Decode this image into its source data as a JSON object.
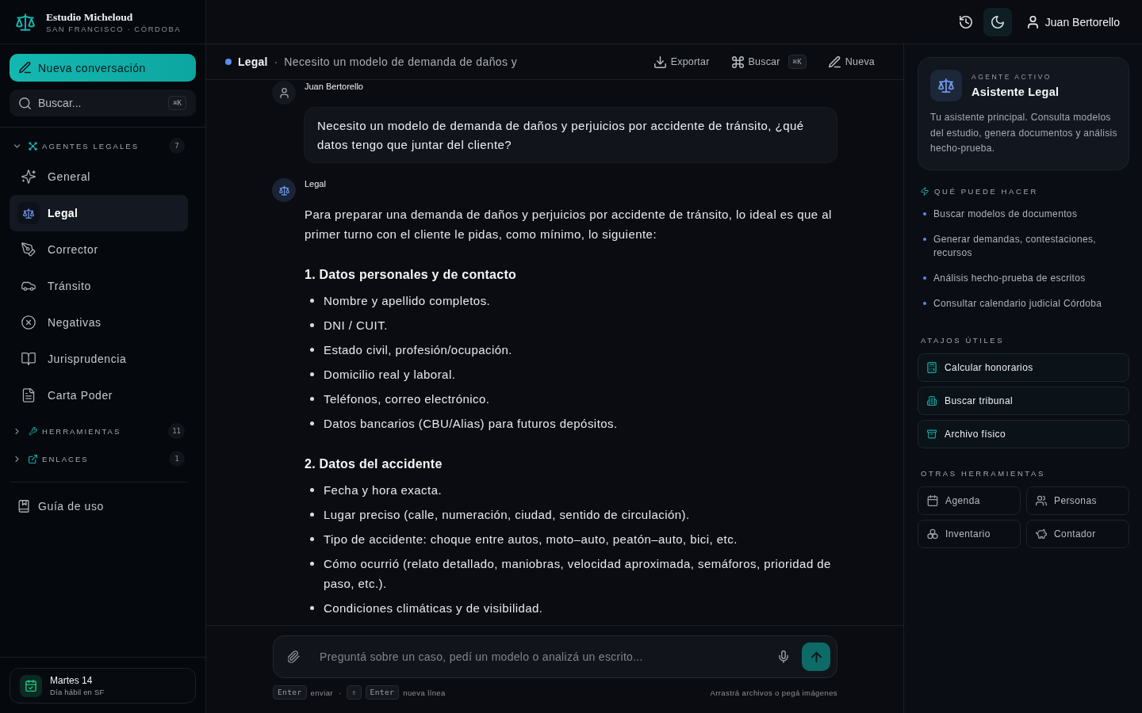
{
  "brand": {
    "name": "Estudio Micheloud",
    "subtitle": "SAN FRANCISCO · CÓRDOBA"
  },
  "topbar": {
    "theme_button": {
      "active": true
    },
    "user": "Juan Bertorello"
  },
  "sidebar": {
    "new_button": "Nueva conversación",
    "search": {
      "placeholder": "Buscar...",
      "shortcut": "⌘K"
    },
    "sections": [
      {
        "title": "AGENTES LEGALES",
        "count": "7",
        "expanded": true,
        "items": [
          {
            "label": "General",
            "selected": false
          },
          {
            "label": "Legal",
            "selected": true
          },
          {
            "label": "Corrector",
            "selected": false
          },
          {
            "label": "Tránsito",
            "selected": false
          },
          {
            "label": "Negativas",
            "selected": false
          },
          {
            "label": "Jurisprudencia",
            "selected": false
          },
          {
            "label": "Carta Poder",
            "selected": false
          }
        ]
      },
      {
        "title": "HERRAMIENTAS",
        "count": "11",
        "expanded": false
      },
      {
        "title": "ENLACES",
        "count": "1",
        "expanded": false
      }
    ],
    "guide_link": "Guía de uso",
    "day_card": {
      "title": "Martes 14",
      "subtitle": "Día hábil en SF"
    }
  },
  "chat": {
    "agent": "Legal",
    "separator": "·",
    "title": "Necesito un modelo de demanda de daños y",
    "actions": [
      {
        "label": "Exportar"
      },
      {
        "label": "Buscar",
        "shortcut": "⌘K"
      },
      {
        "label": "Nueva"
      }
    ],
    "messages": [
      {
        "kind": "user",
        "author": "Juan Bertorello",
        "text": "Necesito un modelo de demanda de daños y perjuicios por accidente de tránsito, ¿qué datos tengo que juntar del cliente?"
      },
      {
        "kind": "assistant",
        "author": "Legal",
        "intro": "Para preparar una demanda de daños y perjuicios por accidente de tránsito, lo ideal es que al primer turno con el cliente le pidas, como mínimo, lo siguiente:",
        "sections": [
          {
            "heading": "1. Datos personales y de contacto",
            "items": [
              "Nombre y apellido completos.",
              "DNI / CUIT.",
              "Estado civil, profesión/ocupación.",
              "Domicilio real y laboral.",
              "Teléfonos, correo electrónico.",
              "Datos bancarios (CBU/Alias) para futuros depósitos."
            ]
          },
          {
            "heading": "2. Datos del accidente",
            "items": [
              "Fecha y hora exacta.",
              "Lugar preciso (calle, numeración, ciudad, sentido de circulación).",
              "Tipo de accidente: choque entre autos, moto–auto, peatón–auto, bici, etc.",
              "Cómo ocurrió (relato detallado, maniobras, velocidad aproximada, semáforos, prioridad de paso, etc.).",
              "Condiciones climáticas y de visibilidad."
            ]
          }
        ]
      }
    ],
    "composer": {
      "placeholder": "Preguntá sobre un caso, pedí un modelo o analizá un escrito...",
      "hints": [
        {
          "kind": "key",
          "text": "Enter"
        },
        {
          "kind": "text",
          "text": "enviar"
        },
        {
          "kind": "separator",
          "text": "·"
        },
        {
          "kind": "key",
          "text": "⇧"
        },
        {
          "kind": "key",
          "text": "Enter"
        },
        {
          "kind": "text",
          "text": "nueva línea"
        }
      ],
      "drop_hint": "Arrastrá archivos o pegá imágenes"
    }
  },
  "panel": {
    "agent_card": {
      "eyebrow": "AGENTE ACTIVO",
      "name": "Asistente Legal",
      "description": "Tu asistente principal. Consulta modelos del estudio, genera documentos y análisis hecho-prueba."
    },
    "capabilities": {
      "title": "QUÉ PUEDE HACER",
      "items": [
        "Buscar modelos de documentos",
        "Generar demandas, contestaciones, recursos",
        "Análisis hecho-prueba de escritos",
        "Consultar calendario judicial Córdoba"
      ]
    },
    "shortcuts": {
      "title": "ATAJOS ÚTILES",
      "items": [
        {
          "label": "Calcular honorarios"
        },
        {
          "label": "Buscar tribunal"
        },
        {
          "label": "Archivo físico"
        }
      ]
    },
    "other_tools": {
      "title": "OTRAS HERRAMIENTAS",
      "items": [
        {
          "label": "Agenda"
        },
        {
          "label": "Personas"
        },
        {
          "label": "Inventario"
        },
        {
          "label": "Contador"
        }
      ]
    }
  }
}
